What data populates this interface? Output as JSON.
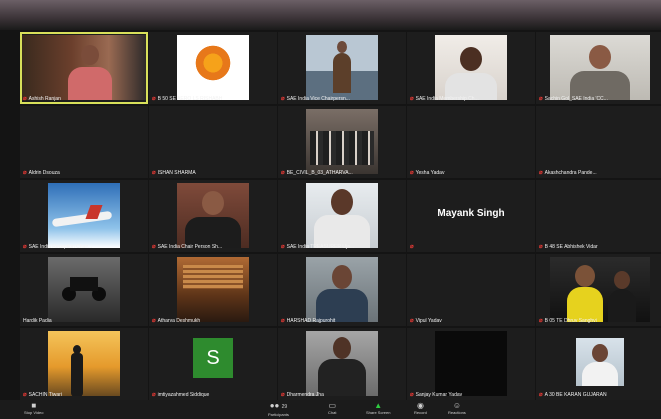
{
  "featured_name": "Mayank Singh",
  "avatar_letter": "S",
  "tiles": [
    {
      "name": "Ashish Ranjan"
    },
    {
      "name": "B 50 SE AERO LS RISHABH"
    },
    {
      "name": "SAE India Vice Chairpersn..."
    },
    {
      "name": "SAE India Membership Ch..."
    },
    {
      "name": "Sachin Gol_SAE India 'CC..."
    },
    {
      "name": "Aldrin Dsouza"
    },
    {
      "name": "ISHAN SHARMA"
    },
    {
      "name": "BE_CIVIL_B_03_ATHARVA..."
    },
    {
      "name": "Yesha Yadav"
    },
    {
      "name": "Akashchandra Pande..."
    },
    {
      "name": "SAE India Reception Chair..."
    },
    {
      "name": "SAE India Chair Person Sh..."
    },
    {
      "name": "SAE India TREASURER Uja..."
    },
    {
      "name": ""
    },
    {
      "name": "B 48 SE Abhishek Vidar"
    },
    {
      "name": "Hardik Padia"
    },
    {
      "name": "Atharva Deshmukh"
    },
    {
      "name": "HARSHAD Rajpurohit"
    },
    {
      "name": "Vipul Yadav"
    },
    {
      "name": "B 05 TE Dhruv Sanghvi"
    },
    {
      "name": "SACHIN Tiwari"
    },
    {
      "name": "imtiyazahmed Siddique"
    },
    {
      "name": "Dharmendra Jha"
    },
    {
      "name": "Sanjay Kumar Yadav"
    },
    {
      "name": "A 30 BE KARAN GUJARAN"
    }
  ],
  "toolbar": {
    "stop_video": "Stop Video",
    "participants_count": "29",
    "participants": "Participants",
    "chat": "Chat",
    "share_screen": "Share Screen",
    "record": "Record",
    "reactions": "Reactions"
  }
}
